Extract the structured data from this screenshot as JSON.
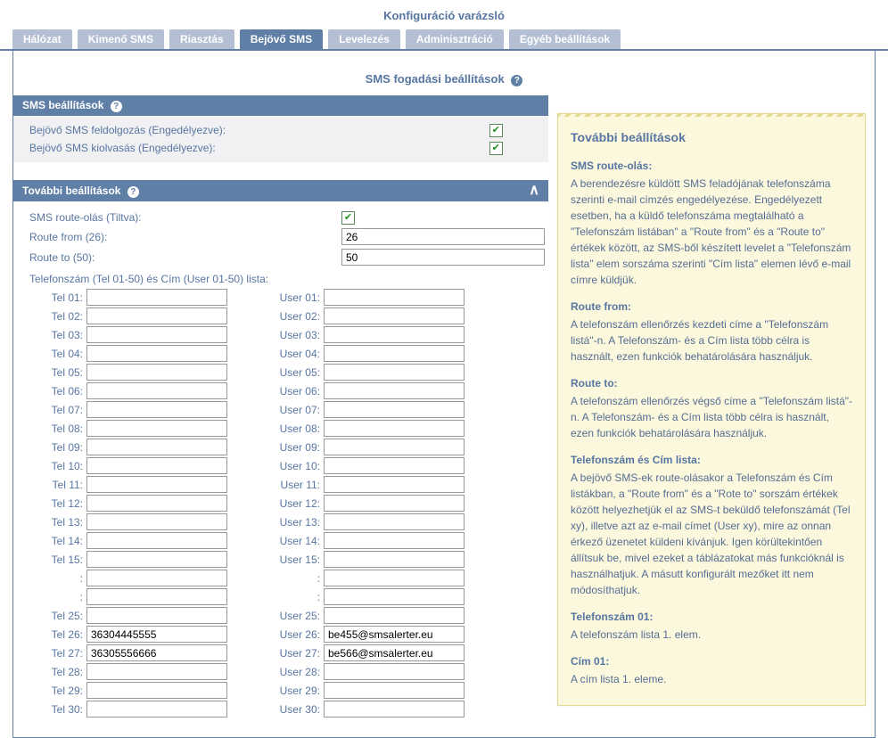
{
  "title": "Konfiguráció varázsló",
  "tabs": [
    {
      "label": "Hálózat",
      "active": false
    },
    {
      "label": "Kimenő SMS",
      "active": false
    },
    {
      "label": "Riasztás",
      "active": false
    },
    {
      "label": "Bejövő SMS",
      "active": true
    },
    {
      "label": "Levelezés",
      "active": false
    },
    {
      "label": "Adminisztráció",
      "active": false
    },
    {
      "label": "Egyéb beállítások",
      "active": false
    }
  ],
  "subheading": "SMS fogadási beállítások",
  "sections": {
    "sms_settings_title": "SMS beállítások",
    "more_settings_title": "További beállítások"
  },
  "sms_settings": {
    "rxproc_label": "Bejövő SMS feldolgozás (Engedélyezve):",
    "rxproc_checked": true,
    "rxread_label": "Bejövő SMS kiolvasás (Engedélyezve):",
    "rxread_checked": true
  },
  "more": {
    "route_enable_label": "SMS route-olás (Tiltva):",
    "route_enable_checked": true,
    "route_from_label": "Route from (26):",
    "route_from_value": "26",
    "route_to_label": "Route to (50):",
    "route_to_value": "50",
    "list_header": "Telefonszám (Tel 01-50) és Cím (User 01-50) lista:",
    "rows": [
      {
        "tel_label": "Tel 01:",
        "tel_val": "",
        "user_label": "User 01:",
        "user_val": ""
      },
      {
        "tel_label": "Tel 02:",
        "tel_val": "",
        "user_label": "User 02:",
        "user_val": ""
      },
      {
        "tel_label": "Tel 03:",
        "tel_val": "",
        "user_label": "User 03:",
        "user_val": ""
      },
      {
        "tel_label": "Tel 04:",
        "tel_val": "",
        "user_label": "User 04:",
        "user_val": ""
      },
      {
        "tel_label": "Tel 05:",
        "tel_val": "",
        "user_label": "User 05:",
        "user_val": ""
      },
      {
        "tel_label": "Tel 06:",
        "tel_val": "",
        "user_label": "User 06:",
        "user_val": ""
      },
      {
        "tel_label": "Tel 07:",
        "tel_val": "",
        "user_label": "User 07:",
        "user_val": ""
      },
      {
        "tel_label": "Tel 08:",
        "tel_val": "",
        "user_label": "User 08:",
        "user_val": ""
      },
      {
        "tel_label": "Tel 09:",
        "tel_val": "",
        "user_label": "User 09:",
        "user_val": ""
      },
      {
        "tel_label": "Tel 10:",
        "tel_val": "",
        "user_label": "User 10:",
        "user_val": ""
      },
      {
        "tel_label": "Tel 11:",
        "tel_val": "",
        "user_label": "User 11:",
        "user_val": ""
      },
      {
        "tel_label": "Tel 12:",
        "tel_val": "",
        "user_label": "User 12:",
        "user_val": ""
      },
      {
        "tel_label": "Tel 13:",
        "tel_val": "",
        "user_label": "User 13:",
        "user_val": ""
      },
      {
        "tel_label": "Tel 14:",
        "tel_val": "",
        "user_label": "User 14:",
        "user_val": ""
      },
      {
        "tel_label": "Tel 15:",
        "tel_val": "",
        "user_label": "User 15:",
        "user_val": ""
      },
      {
        "tel_label": ":",
        "tel_val": "",
        "user_label": ":",
        "user_val": ""
      },
      {
        "tel_label": ":",
        "tel_val": "",
        "user_label": ":",
        "user_val": ""
      },
      {
        "tel_label": "Tel 25:",
        "tel_val": "",
        "user_label": "User 25:",
        "user_val": ""
      },
      {
        "tel_label": "Tel 26:",
        "tel_val": "36304445555",
        "user_label": "User 26:",
        "user_val": "be455@smsalerter.eu"
      },
      {
        "tel_label": "Tel 27:",
        "tel_val": "36305556666",
        "user_label": "User 27:",
        "user_val": "be566@smsalerter.eu"
      },
      {
        "tel_label": "Tel 28:",
        "tel_val": "",
        "user_label": "User 28:",
        "user_val": ""
      },
      {
        "tel_label": "Tel 29:",
        "tel_val": "",
        "user_label": "User 29:",
        "user_val": ""
      },
      {
        "tel_label": "Tel 30:",
        "tel_val": "",
        "user_label": "User 30:",
        "user_val": ""
      }
    ]
  },
  "help": {
    "title": "További beállítások",
    "sections": [
      {
        "heading": "SMS route-olás:",
        "body": "A berendezésre küldött SMS feladójának telefonszáma szerinti e-mail címzés engedélyezése. Engedélyezett esetben, ha a küldő telefonszáma megtalálható a \"Telefonszám listában\" a \"Route from\" és a \"Route to\" értékek között, az SMS-ből készített levelet a \"Telefonszám lista\" elem sorszáma szerinti \"Cím lista\" elemen lévő e-mail címre küldjük."
      },
      {
        "heading": "Route from:",
        "body": "A telefonszám ellenőrzés kezdeti címe a \"Telefonszám listá\"-n. A Telefonszám- és a Cím lista több célra is használt, ezen funkciók behatárolására használjuk."
      },
      {
        "heading": "Route to:",
        "body": "A telefonszám ellenőrzés végső címe a \"Telefonszám listá\"-n. A Telefonszám- és a Cím lista több célra is használt, ezen funkciók behatárolására használjuk."
      },
      {
        "heading": "Telefonszám és Cím lista:",
        "body": "A bejövő SMS-ek route-olásakor a Telefonszám és Cím listákban, a \"Route from\" és a \"Rote to\" sorszám értékek között helyezhetjük el az SMS-t beküldő telefonszámát (Tel xy), illetve azt az e-mail címet (User xy), mire az onnan érkező üzenetet küldeni kívánjuk.\nIgen körültekintően állítsuk be, mivel ezeket a táblázatokat más funkcióknál is használhatjuk. A másutt konfigurált mezőket itt nem módosíthatjuk."
      },
      {
        "heading": "Telefonszám 01:",
        "body": "A telefonszám lista 1. elem."
      },
      {
        "heading": "Cím 01:",
        "body": "A cím lista 1. eleme."
      }
    ]
  },
  "icons": {
    "help": "?",
    "chevron_up": "∧"
  }
}
